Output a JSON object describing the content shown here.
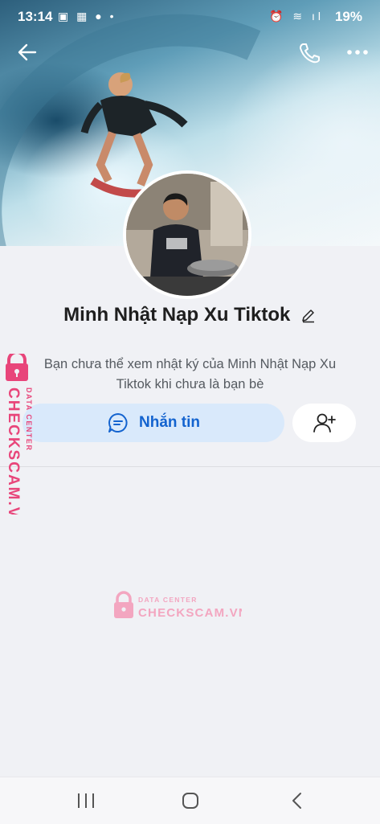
{
  "status": {
    "time": "13:14",
    "left_icons": "▣ ▦ ●  •",
    "right_icons": "⏰ ≋ ıl",
    "battery": "19%"
  },
  "header": {
    "back_icon": "arrow-left-icon",
    "call_icon": "phone-icon",
    "more_icon": "more-dots-icon"
  },
  "profile": {
    "name": "Minh Nhật Nạp Xu Tiktok",
    "privacy_notice": "Bạn chưa thể xem nhật ký của Minh Nhật Nạp Xu Tiktok khi chưa là bạn bè"
  },
  "actions": {
    "message_label": "Nhắn tin",
    "message_icon": "chat-bubble-icon",
    "add_friend_icon": "add-user-icon"
  },
  "watermark": {
    "brand": "CHECKSCAM.VN",
    "sub": "DATA CENTER",
    "color": "#e8457a"
  },
  "colors": {
    "accent": "#1363cf",
    "message_button_bg": "#d9e9fb",
    "page_bg": "#f0f1f5"
  }
}
